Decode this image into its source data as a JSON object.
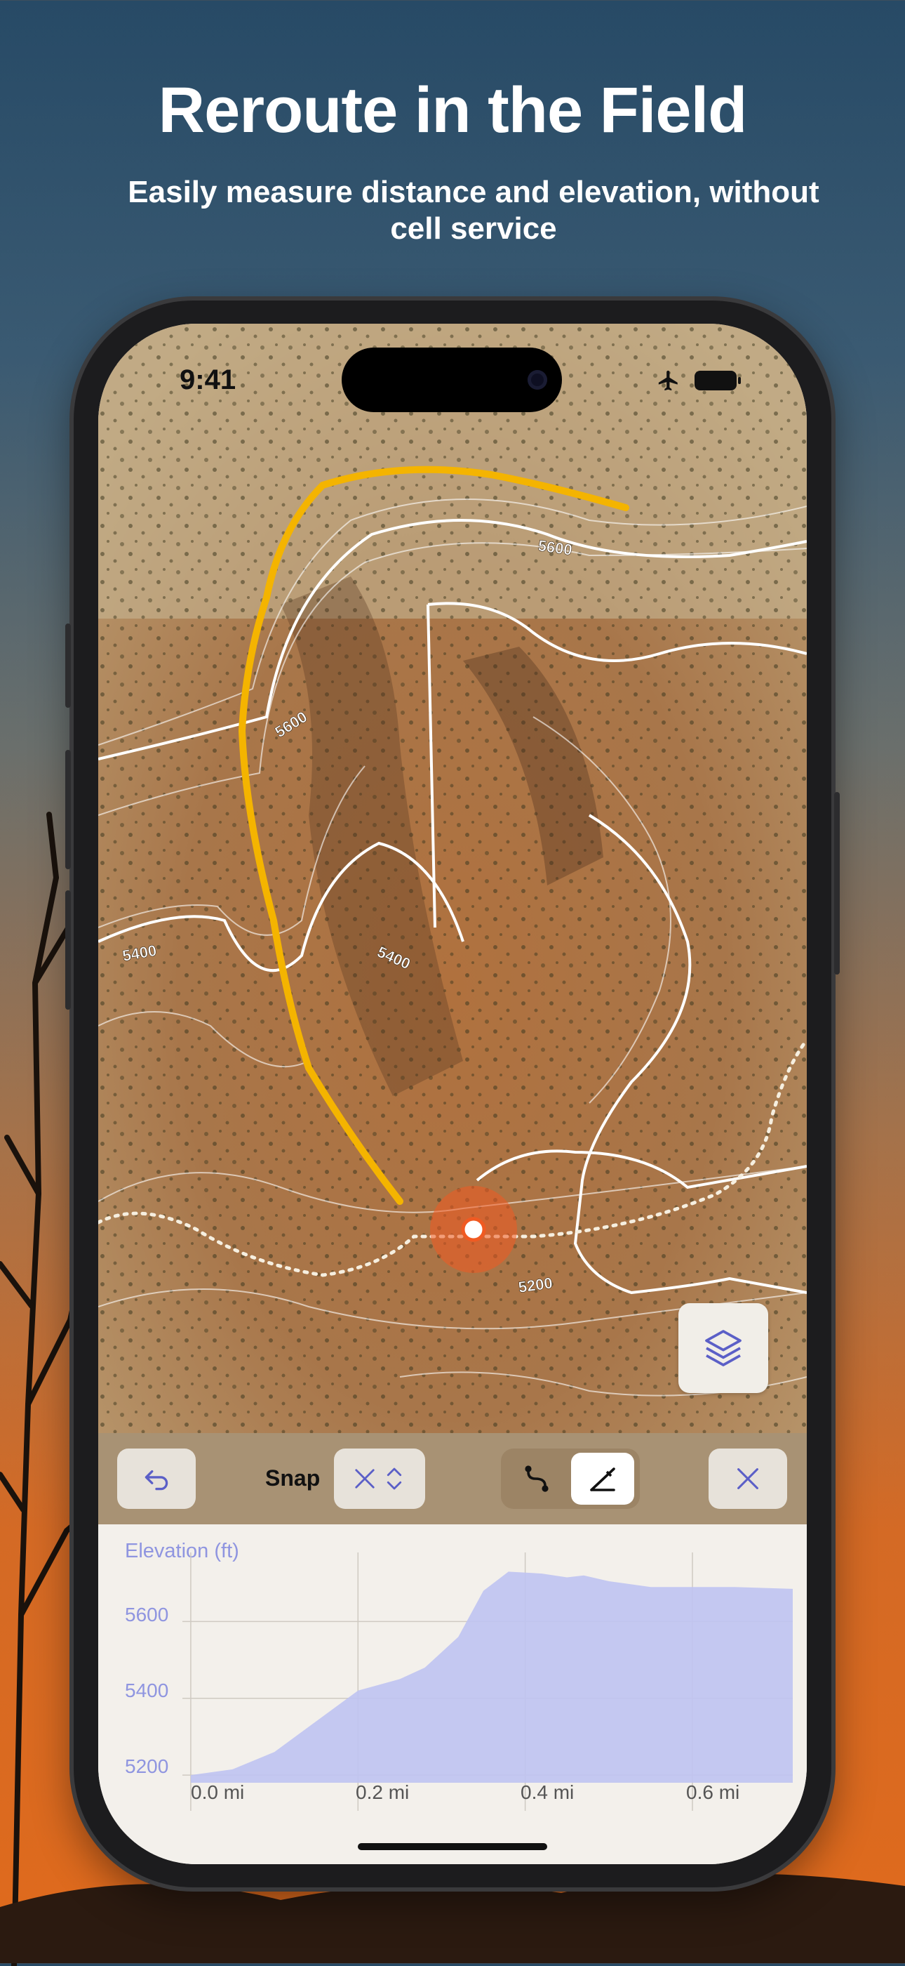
{
  "marketing": {
    "headline": "Reroute in the Field",
    "subheadline": "Easily measure distance and elevation, without cell service"
  },
  "status_bar": {
    "time": "9:41",
    "icons": [
      "airplane-mode-icon",
      "battery-icon"
    ]
  },
  "map": {
    "contour_labels": [
      "5600",
      "5600",
      "5400",
      "5400",
      "5200"
    ],
    "route_color": "#f4b400",
    "trail_style": "dotted",
    "position_marker_color": "#f05a22"
  },
  "toolbar": {
    "undo_icon": "undo-icon",
    "snap_label": "Snap",
    "snap_icons": [
      "x-icon",
      "chevron-up-down-icon"
    ],
    "mode_icons": [
      "route-snap-icon",
      "draw-icon"
    ],
    "close_icon": "close-icon"
  },
  "layers_button_icon": "layers-icon",
  "elevation": {
    "title": "Elevation (ft)",
    "y_ticks": [
      "5600",
      "5400",
      "5200"
    ],
    "x_ticks": [
      "0.0 mi",
      "0.2 mi",
      "0.4 mi",
      "0.6 mi"
    ]
  },
  "chart_data": {
    "type": "area",
    "title": "Elevation (ft)",
    "xlabel": "",
    "ylabel": "",
    "x": [
      0.0,
      0.05,
      0.1,
      0.15,
      0.2,
      0.25,
      0.28,
      0.32,
      0.35,
      0.38,
      0.42,
      0.45,
      0.47,
      0.5,
      0.55,
      0.6,
      0.65,
      0.72
    ],
    "values": [
      5200,
      5215,
      5260,
      5340,
      5420,
      5450,
      5480,
      5560,
      5680,
      5730,
      5725,
      5715,
      5720,
      5705,
      5690,
      5690,
      5690,
      5685
    ],
    "xlim": [
      -0.01,
      0.72
    ],
    "ylim": [
      5180,
      5780
    ],
    "grid": true,
    "color": "#bfc3f2"
  },
  "colors": {
    "accent": "#5b5fc7",
    "chart_fill": "#bfc3f2",
    "chart_text": "#8f95e0"
  }
}
